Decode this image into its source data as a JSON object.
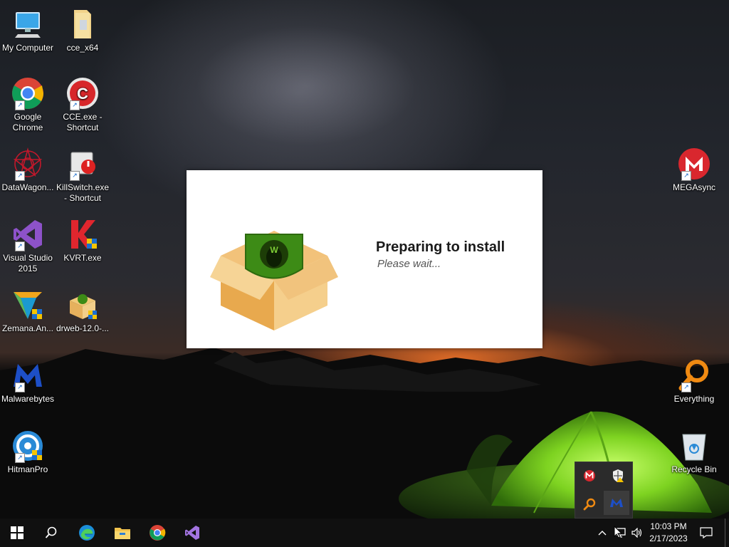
{
  "desktop": {
    "icons_left": [
      {
        "name": "icon-my-computer",
        "label": "My Computer"
      },
      {
        "name": "icon-cce-x64",
        "label": "cce_x64"
      },
      {
        "name": "icon-google-chrome",
        "label": "Google Chrome"
      },
      {
        "name": "icon-cce-shortcut",
        "label": "CCE.exe - Shortcut"
      },
      {
        "name": "icon-datawagon",
        "label": "DataWagon..."
      },
      {
        "name": "icon-killswitch",
        "label": "KillSwitch.exe - Shortcut"
      },
      {
        "name": "icon-visual-studio",
        "label": "Visual Studio 2015"
      },
      {
        "name": "icon-kvrt",
        "label": "KVRT.exe"
      },
      {
        "name": "icon-zemana",
        "label": "Zemana.An..."
      },
      {
        "name": "icon-drweb",
        "label": "drweb-12.0-..."
      },
      {
        "name": "icon-malwarebytes",
        "label": "Malwarebytes"
      },
      {
        "name": "icon-hitmanpro",
        "label": "HitmanPro"
      }
    ],
    "icons_right": [
      {
        "name": "icon-megasync",
        "label": "MEGAsync"
      },
      {
        "name": "icon-everything",
        "label": "Everything"
      },
      {
        "name": "icon-recycle-bin",
        "label": "Recycle Bin"
      }
    ]
  },
  "installer": {
    "title": "Preparing to install",
    "subtitle": "Please wait..."
  },
  "taskbar": {
    "time": "10:03 PM",
    "date": "2/17/2023"
  },
  "colors": {
    "taskbar": "#101010",
    "drweb_green": "#3d8b16",
    "mega_red": "#d9272e",
    "vs_purple": "#68217a"
  }
}
